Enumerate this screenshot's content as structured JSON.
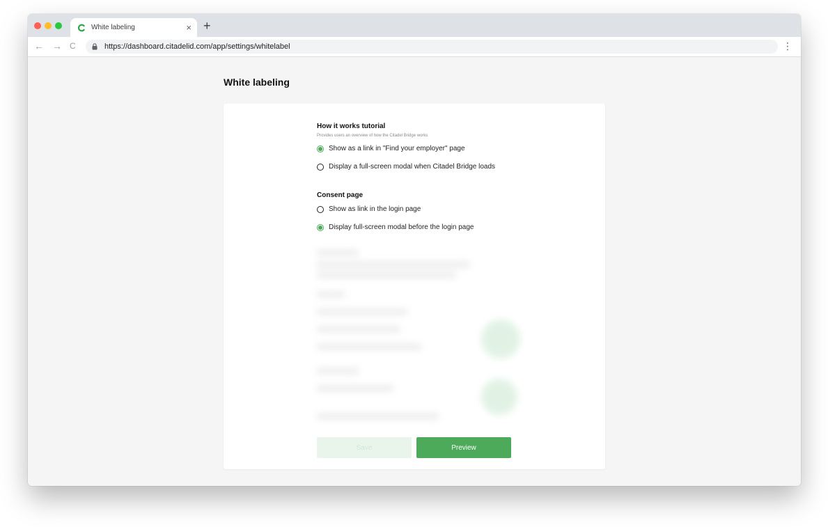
{
  "browser": {
    "tab_title": "White labeling",
    "tab_close": "×",
    "new_tab": "+",
    "url": "https://dashboard.citadelid.com/app/settings/whitelabel",
    "nav": {
      "back": "←",
      "forward": "→",
      "reload": "C"
    },
    "menu": "⋮"
  },
  "colors": {
    "accent": "#4caa5a",
    "save_disabled_bg": "#e9f5eb"
  },
  "page": {
    "title": "White labeling",
    "sections": [
      {
        "title": "How it works tutorial",
        "subtitle": "Provides users an overview of how the Citadel Bridge works",
        "options": [
          {
            "label": "Show as a link in \"Find your employer\" page",
            "selected": true
          },
          {
            "label": "Display a full-screen modal when Citadel Bridge loads",
            "selected": false
          }
        ]
      },
      {
        "title": "Consent page",
        "options": [
          {
            "label": "Show as link in the login page",
            "selected": false
          },
          {
            "label": "Display full-screen modal before the login page",
            "selected": true
          }
        ]
      }
    ],
    "buttons": {
      "save": "Save",
      "preview": "Preview"
    }
  }
}
